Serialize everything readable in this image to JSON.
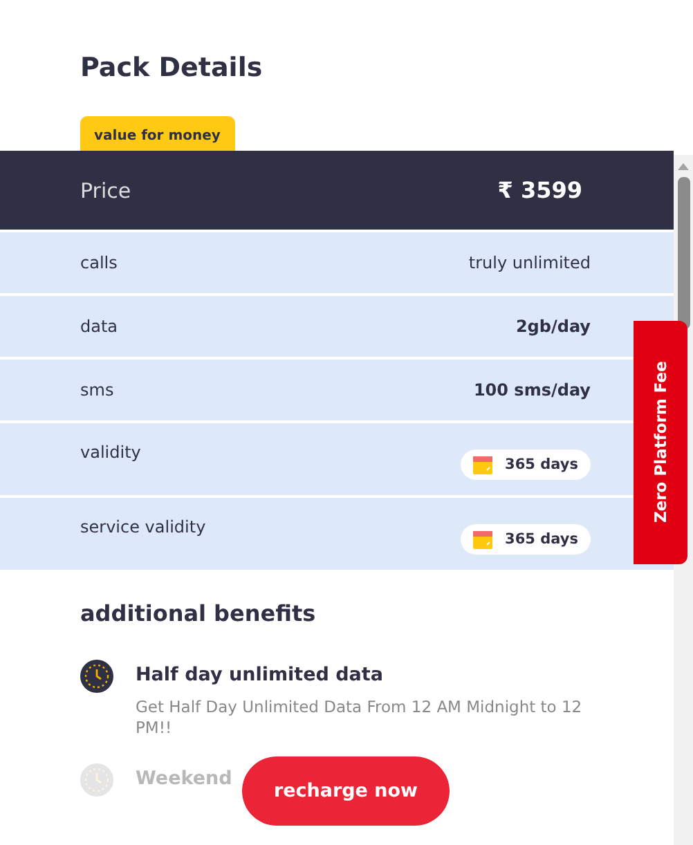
{
  "title": "Pack Details",
  "tag": "value for money",
  "price": {
    "label": "Price",
    "value": "₹ 3599"
  },
  "rows": [
    {
      "label": "calls",
      "value": "truly unlimited",
      "kind": "plain"
    },
    {
      "label": "data",
      "value": "2gb/day",
      "kind": "bold"
    },
    {
      "label": "sms",
      "value": "100 sms/day",
      "kind": "bold"
    },
    {
      "label": "validity",
      "value": "365 days",
      "kind": "badge"
    },
    {
      "label": "service validity",
      "value": "365 days",
      "kind": "badge"
    }
  ],
  "side_tab": "Zero Platform Fee",
  "benefits_title": "additional benefits",
  "benefits": [
    {
      "title": "Half day unlimited data",
      "description": "Get Half Day Unlimited Data From 12 AM Midnight to 12 PM!!",
      "faded": false
    },
    {
      "title": "Weekend",
      "faded": true
    }
  ],
  "button": "recharge now"
}
